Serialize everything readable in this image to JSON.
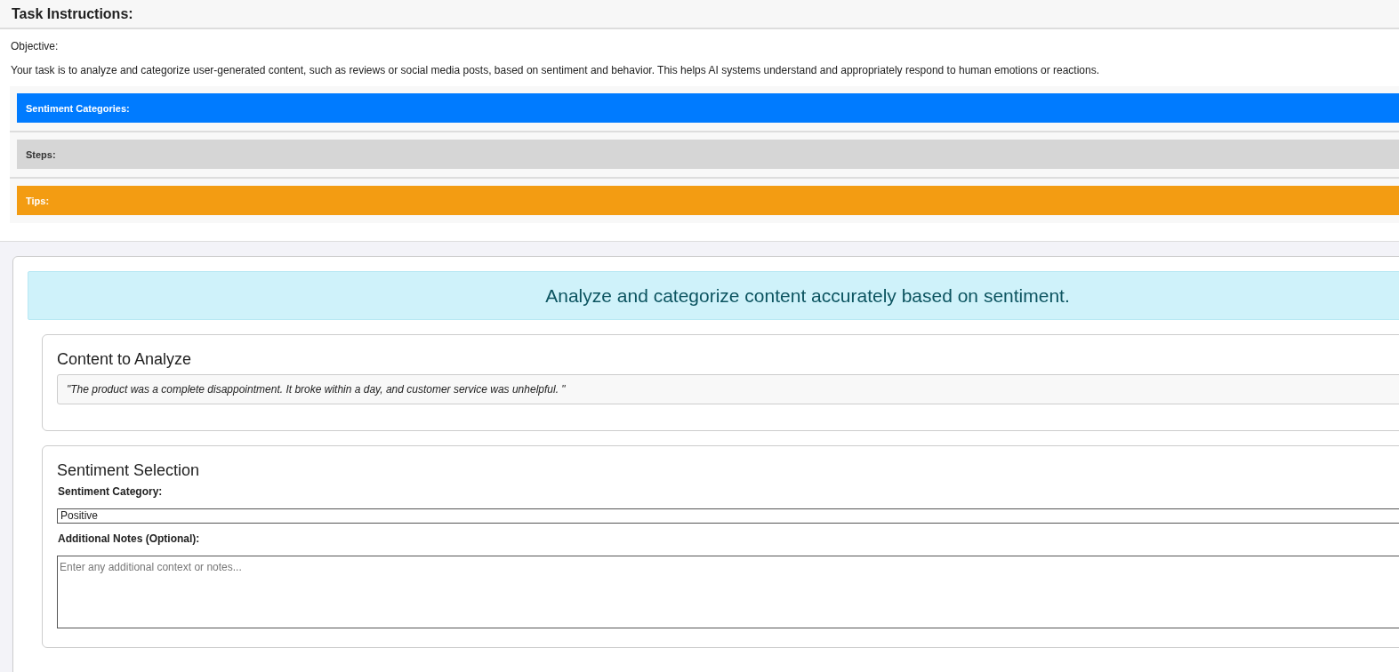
{
  "header": {
    "title": "Task Instructions:"
  },
  "objective": {
    "label": "Objective:",
    "text": "Your task is to analyze and categorize user-generated content, such as reviews or social media posts, based on sentiment and behavior. This helps AI systems understand and appropriately respond to human emotions or reactions."
  },
  "sections": [
    {
      "title": "Sentiment Categories:",
      "kind": "primary"
    },
    {
      "title": "Steps:",
      "kind": "secondary"
    },
    {
      "title": "Tips:",
      "kind": "warning"
    }
  ],
  "banner": "Analyze and categorize content accurately based on sentiment.",
  "content_card": {
    "title": "Content to Analyze",
    "quote": "\"The product was a complete disappointment. It broke within a day, and customer service was unhelpful. \""
  },
  "selection_card": {
    "title": "Sentiment Selection",
    "category_label": "Sentiment Category:",
    "category_value": "Positive",
    "notes_label": "Additional Notes (Optional):",
    "notes_placeholder": "Enter any additional context or notes..."
  }
}
